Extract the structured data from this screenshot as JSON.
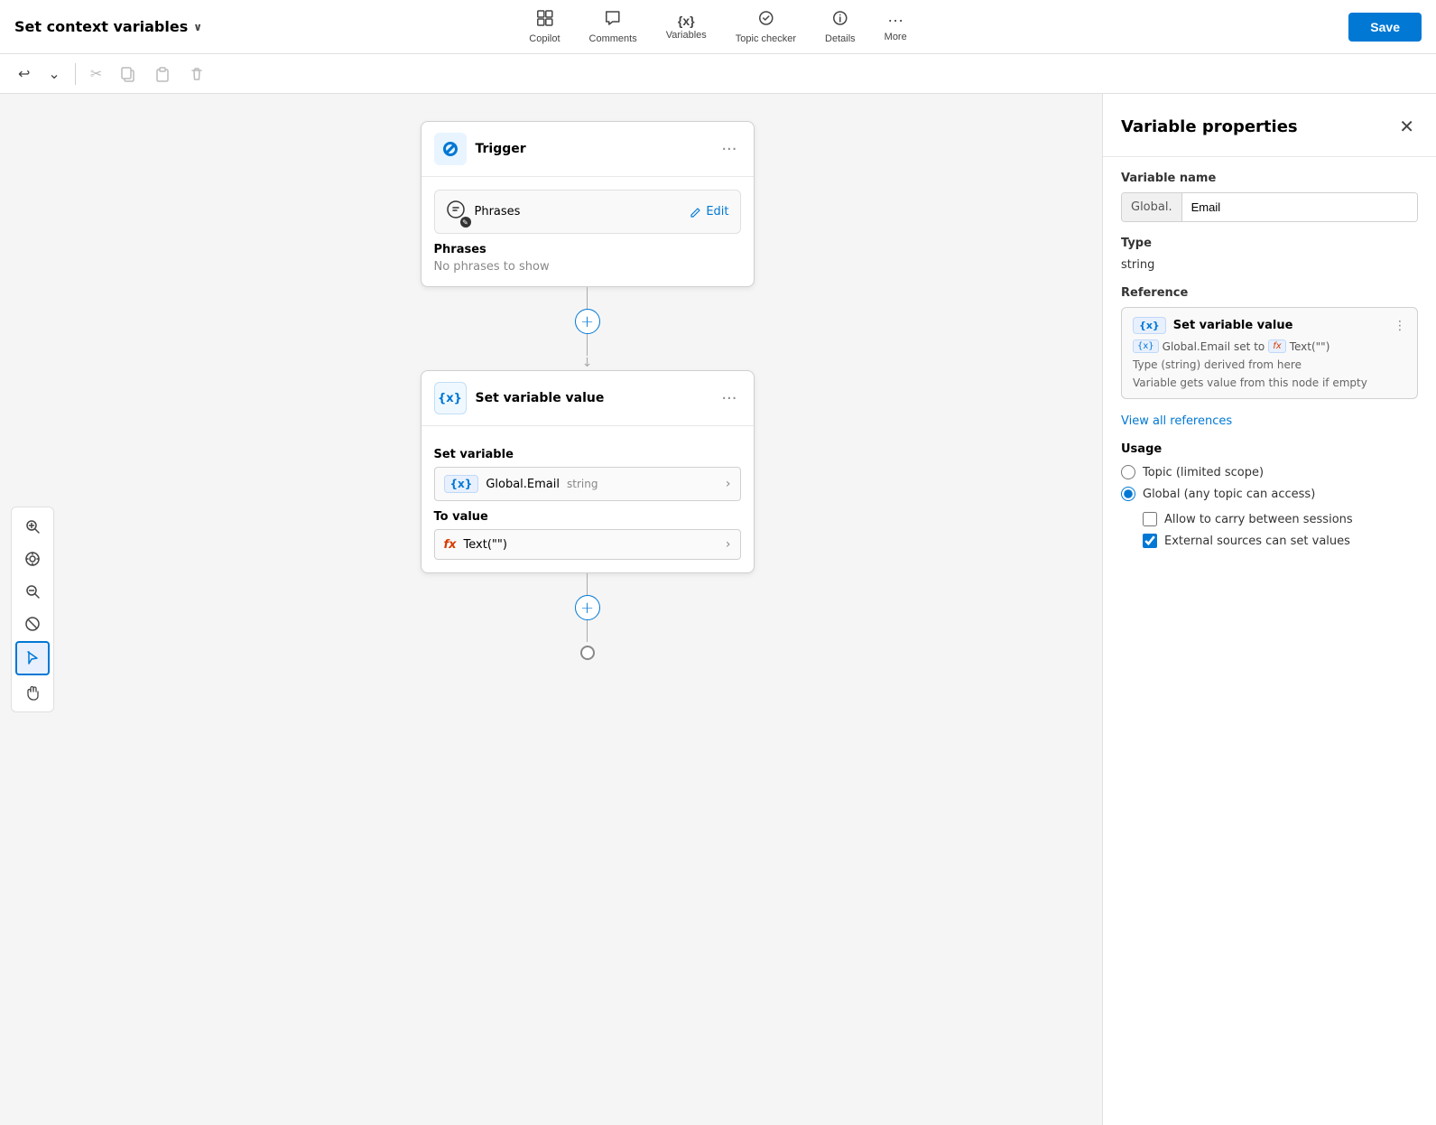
{
  "topbar": {
    "title": "Set context variables",
    "save_label": "Save",
    "nav_items": [
      {
        "id": "copilot",
        "label": "Copilot",
        "icon": "⊞"
      },
      {
        "id": "comments",
        "label": "Comments",
        "icon": "💬"
      },
      {
        "id": "variables",
        "label": "Variables",
        "icon": "{x}"
      },
      {
        "id": "topic_checker",
        "label": "Topic checker",
        "icon": "🩺"
      },
      {
        "id": "details",
        "label": "Details",
        "icon": "ℹ"
      },
      {
        "id": "more",
        "label": "More",
        "icon": "···"
      }
    ]
  },
  "toolbar": {
    "buttons": [
      {
        "id": "undo",
        "icon": "↩",
        "label": "Undo"
      },
      {
        "id": "redo",
        "icon": "⌄",
        "label": "Redo"
      },
      {
        "id": "cut",
        "icon": "✂",
        "label": "Cut"
      },
      {
        "id": "copy",
        "icon": "⧉",
        "label": "Copy"
      },
      {
        "id": "paste",
        "icon": "📋",
        "label": "Paste"
      },
      {
        "id": "delete",
        "icon": "🗑",
        "label": "Delete"
      }
    ]
  },
  "canvas": {
    "trigger_node": {
      "title": "Trigger",
      "phrases_sub_label": "Phrases",
      "edit_label": "Edit",
      "phrases_heading": "Phrases",
      "phrases_empty": "No phrases to show"
    },
    "set_variable_node": {
      "title": "Set variable value",
      "set_variable_label": "Set variable",
      "var_badge": "{x}",
      "var_name": "Global.Email",
      "var_type": "string",
      "to_value_label": "To value",
      "fx_value": "Text(\"\")"
    }
  },
  "panel": {
    "title": "Variable properties",
    "var_name_label": "Variable name",
    "var_prefix": "Global.",
    "var_name_value": "Email",
    "type_label": "Type",
    "type_value": "string",
    "reference_label": "Reference",
    "ref_card": {
      "title": "Set variable value",
      "badge": "{x}",
      "var_name": "Global.Email",
      "set_to_text": "set to",
      "fx_badge": "fx",
      "fx_value": "Text(\"\")",
      "description_line1": "Type (string) derived from here",
      "description_line2": "Variable gets value from this node if empty"
    },
    "view_refs_label": "View all references",
    "usage_label": "Usage",
    "usage_options": [
      {
        "id": "topic",
        "label": "Topic (limited scope)",
        "selected": false
      },
      {
        "id": "global",
        "label": "Global (any topic can access)",
        "selected": true
      }
    ],
    "checkboxes": [
      {
        "id": "carry_sessions",
        "label": "Allow to carry between sessions",
        "checked": false
      },
      {
        "id": "external_sources",
        "label": "External sources can set values",
        "checked": true
      }
    ]
  },
  "tools": {
    "zoom_in": "zoom-in",
    "center": "center",
    "zoom_out": "zoom-out",
    "no_fit": "no-fit",
    "select": "select",
    "hand": "hand"
  }
}
